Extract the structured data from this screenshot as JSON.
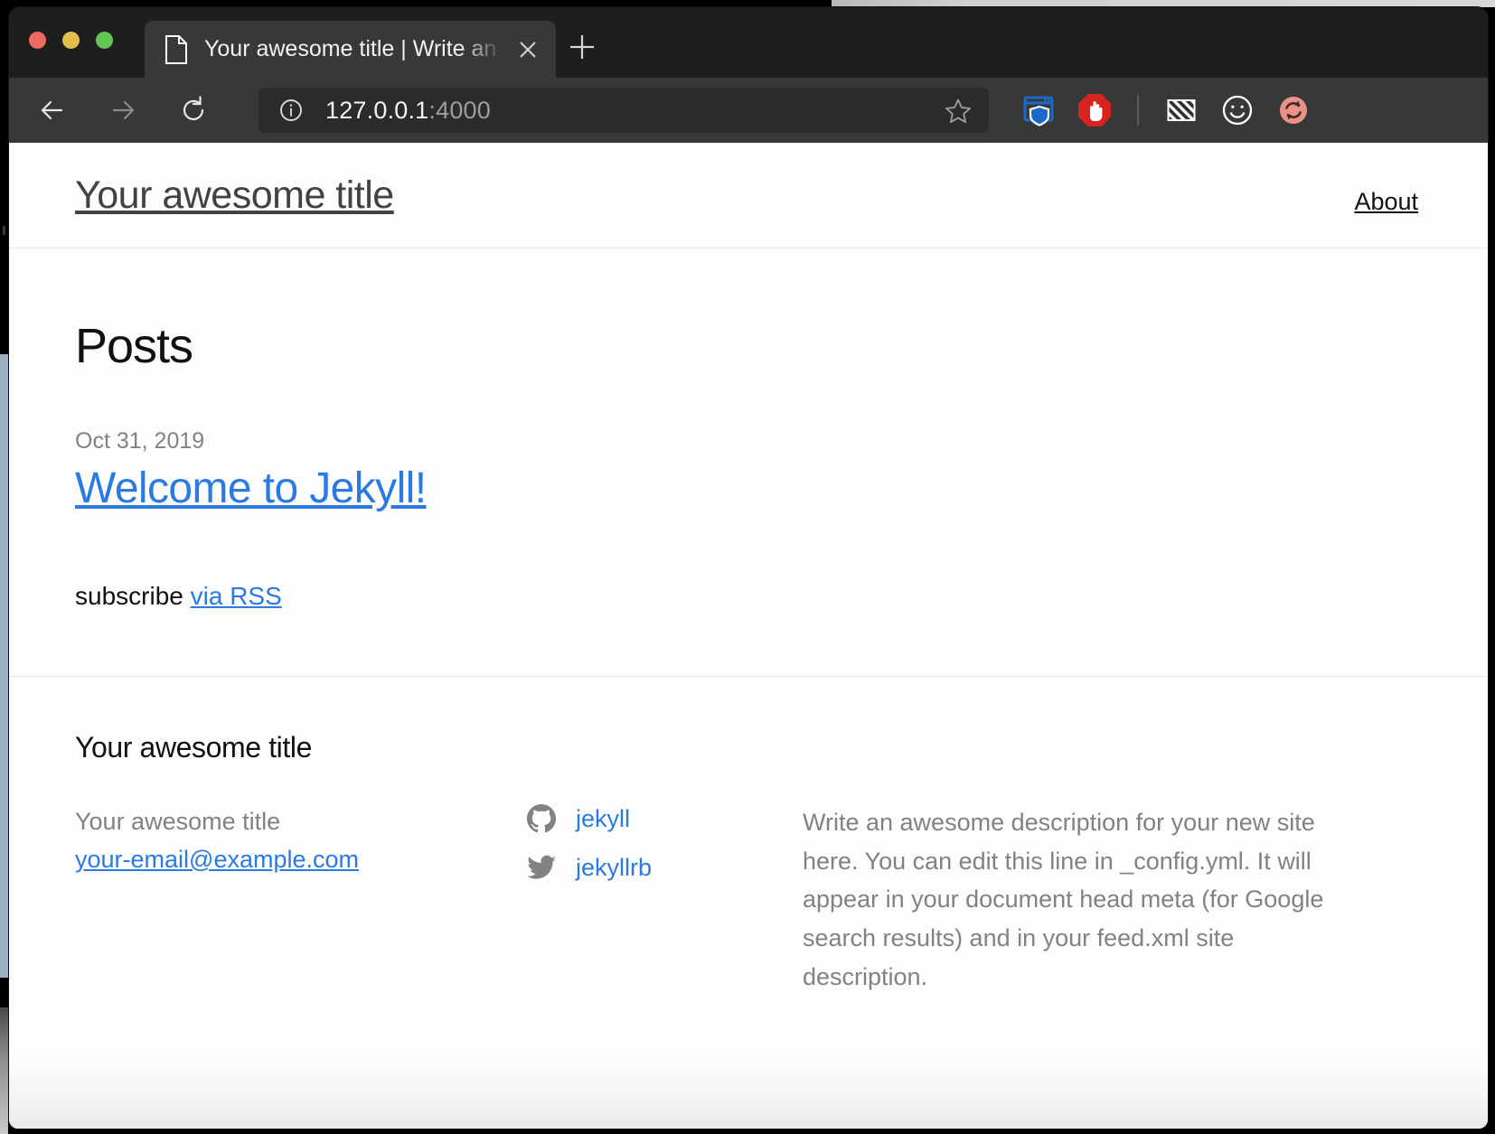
{
  "browser": {
    "window_controls": {
      "close": "close-window",
      "minimize": "minimize-window",
      "maximize": "maximize-window"
    },
    "tab": {
      "title": "Your awesome title | Write an aw",
      "close_label": "×",
      "doc_icon": "document-icon"
    },
    "new_tab_label": "+",
    "nav": {
      "back": "←",
      "forward": "→",
      "reload": "↻"
    },
    "url": {
      "host": "127.0.0.1",
      "port": ":4000",
      "full": "127.0.0.1:4000",
      "info_icon": "info-circle-icon",
      "bookmark_icon": "star-icon"
    },
    "extensions": [
      {
        "name": "browser-shield-icon",
        "label": "shield"
      },
      {
        "name": "adblock-stop-hand-icon",
        "label": "adblock"
      },
      {
        "name": "hatched-square-icon",
        "label": "hatched"
      },
      {
        "name": "smiley-face-icon",
        "label": "smiley"
      },
      {
        "name": "sync-refresh-icon",
        "label": "sync"
      }
    ],
    "colors": {
      "chrome_dark": "#202020",
      "tab_bar": "#1e1e1e",
      "nav_bar": "#383838",
      "url_field": "#2b2b2b",
      "adblock_red": "#d8241f",
      "shield_blue": "#1b6ac9",
      "sync_salmon": "#ea9287"
    }
  },
  "page": {
    "header": {
      "site_title": "Your awesome title",
      "nav": [
        {
          "label": "About"
        }
      ]
    },
    "main": {
      "posts_heading": "Posts",
      "posts": [
        {
          "date": "Oct 31, 2019",
          "title": "Welcome to Jekyll!"
        }
      ],
      "subscribe_prefix": "subscribe ",
      "subscribe_link": "via RSS"
    },
    "footer": {
      "heading": "Your awesome title",
      "contact_name": "Your awesome title",
      "email": "your-email@example.com",
      "social": [
        {
          "icon": "github-icon",
          "label": "jekyll"
        },
        {
          "icon": "twitter-icon",
          "label": "jekyllrb"
        }
      ],
      "description": "Write an awesome description for your new site here. You can edit this line in _config.yml. It will appear in your document head meta (for Google search results) and in your feed.xml site description."
    },
    "colors": {
      "link_blue": "#2a7ae2",
      "muted_gray": "#828282",
      "text_black": "#111111",
      "page_bg": "#fdfdfd",
      "rule": "#e8e8e8"
    }
  }
}
